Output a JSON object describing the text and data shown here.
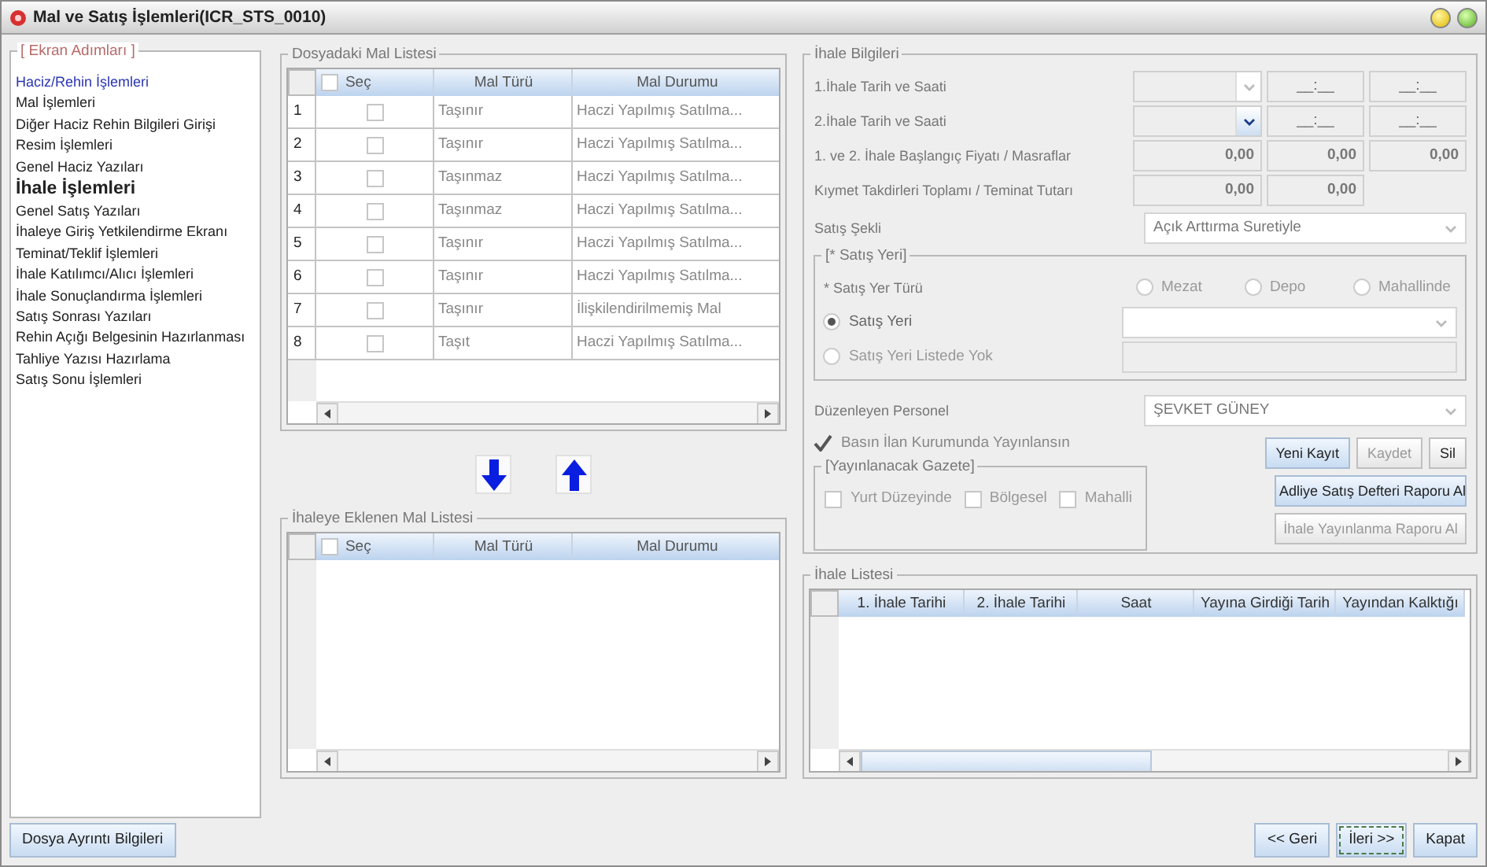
{
  "window": {
    "title": "Mal ve Satış İşlemleri(ICR_STS_0010)"
  },
  "sidebar": {
    "legend": "[ Ekran Adımları ]",
    "items": [
      {
        "label": "Haciz/Rehin İşlemleri",
        "kind": "link",
        "selected": false
      },
      {
        "label": "Mal İşlemleri",
        "kind": "step",
        "selected": false
      },
      {
        "label": "Diğer Haciz Rehin Bilgileri Girişi",
        "kind": "step",
        "selected": false
      },
      {
        "label": "Resim İşlemleri",
        "kind": "step",
        "selected": false
      },
      {
        "label": "Genel Haciz Yazıları",
        "kind": "step",
        "selected": false
      },
      {
        "label": "İhale İşlemleri",
        "kind": "step",
        "selected": true
      },
      {
        "label": "Genel Satış Yazıları",
        "kind": "step",
        "selected": false
      },
      {
        "label": "İhaleye Giriş Yetkilendirme Ekranı",
        "kind": "step",
        "selected": false
      },
      {
        "label": "Teminat/Teklif İşlemleri",
        "kind": "step",
        "selected": false
      },
      {
        "label": "İhale Katılımcı/Alıcı İşlemleri",
        "kind": "step",
        "selected": false
      },
      {
        "label": "İhale Sonuçlandırma İşlemleri",
        "kind": "step",
        "selected": false
      },
      {
        "label": "Satış Sonrası Yazıları",
        "kind": "step",
        "selected": false
      },
      {
        "label": "Rehin Açığı Belgesinin Hazırlanması",
        "kind": "step",
        "selected": false
      },
      {
        "label": "Tahliye Yazısı Hazırlama",
        "kind": "step",
        "selected": false
      },
      {
        "label": "Satış Sonu İşlemleri",
        "kind": "step",
        "selected": false
      }
    ]
  },
  "mal_listesi": {
    "legend": "Dosyadaki Mal Listesi",
    "columns": [
      "Seç",
      "Mal Türü",
      "Mal Durumu"
    ],
    "header_checked": false,
    "rows": [
      {
        "no": "1",
        "checked": false,
        "mal_turu": "Taşınır",
        "mal_durumu": "Haczi Yapılmış Satılma..."
      },
      {
        "no": "2",
        "checked": false,
        "mal_turu": "Taşınır",
        "mal_durumu": "Haczi Yapılmış Satılma..."
      },
      {
        "no": "3",
        "checked": false,
        "mal_turu": "Taşınmaz",
        "mal_durumu": "Haczi Yapılmış Satılma..."
      },
      {
        "no": "4",
        "checked": false,
        "mal_turu": "Taşınmaz",
        "mal_durumu": "Haczi Yapılmış Satılma..."
      },
      {
        "no": "5",
        "checked": false,
        "mal_turu": "Taşınır",
        "mal_durumu": "Haczi Yapılmış Satılma..."
      },
      {
        "no": "6",
        "checked": false,
        "mal_turu": "Taşınır",
        "mal_durumu": "Haczi Yapılmış Satılma..."
      },
      {
        "no": "7",
        "checked": false,
        "mal_turu": "Taşınır",
        "mal_durumu": "İlişkilendirilmemiş Mal"
      },
      {
        "no": "8",
        "checked": false,
        "mal_turu": "Taşıt",
        "mal_durumu": "Haczi Yapılmış Satılma..."
      }
    ]
  },
  "eklenen_listesi": {
    "legend": "İhaleye Eklenen Mal Listesi",
    "columns": [
      "Seç",
      "Mal Türü",
      "Mal Durumu"
    ],
    "header_checked": false
  },
  "ihale_bilgileri": {
    "legend": "İhale Bilgileri",
    "tarih_1": {
      "label": "1.İhale Tarih ve Saati",
      "disabled": true,
      "times": [
        "__:__",
        "__:__"
      ]
    },
    "tarih_2": {
      "label": "2.İhale Tarih ve Saati",
      "disabled": false,
      "times": [
        "__:__",
        "__:__"
      ]
    },
    "fiyat": {
      "label": "1. ve 2. İhale Başlangıç Fiyatı / Masraflar",
      "values": [
        "0,00",
        "0,00",
        "0,00"
      ]
    },
    "kiymet": {
      "label": "Kıymet Takdirleri Toplamı / Teminat Tutarı",
      "values": [
        "0,00",
        "0,00"
      ]
    },
    "satis_sekli": {
      "label": "Satış Şekli",
      "value": "Açık Arttırma Suretiyle"
    },
    "satis_yeri": {
      "legend": "[* Satış Yeri]",
      "type_label": "* Satış Yer Türü",
      "types": [
        {
          "label": "Mezat",
          "selected": false
        },
        {
          "label": "Depo",
          "selected": false
        },
        {
          "label": "Mahallinde",
          "selected": false
        }
      ],
      "options": [
        {
          "label": "Satış Yeri",
          "selected": true
        },
        {
          "label": "Satış Yeri Listede Yok",
          "selected": false
        }
      ]
    },
    "personel": {
      "label": "Düzenleyen Personel",
      "value": "ŞEVKET GÜNEY"
    },
    "basin": {
      "label": "Basın İlan Kurumunda Yayınlansın",
      "checked": true
    },
    "gazete": {
      "legend": "[Yayınlanacak Gazete]",
      "options": [
        {
          "label": "Yurt Düzeyinde",
          "checked": false
        },
        {
          "label": "Bölgesel",
          "checked": false
        },
        {
          "label": "Mahalli",
          "checked": false
        }
      ]
    },
    "buttons": [
      {
        "label": "Yeni Kayıt",
        "kind": "row",
        "highlighted": true,
        "disabled": false
      },
      {
        "label": "Kaydet",
        "kind": "row",
        "highlighted": false,
        "disabled": true
      },
      {
        "label": "Sil",
        "kind": "row",
        "highlighted": false,
        "disabled": false
      },
      {
        "label": "Adliye Satış Defteri Raporu Al",
        "kind": "wide",
        "highlighted": true,
        "disabled": false
      },
      {
        "label": "İhale Yayınlanma Raporu Al",
        "kind": "wide",
        "highlighted": false,
        "disabled": true
      }
    ]
  },
  "ihale_listesi": {
    "legend": "İhale Listesi",
    "columns": [
      "1. İhale Tarihi",
      "2. İhale Tarihi",
      "Saat",
      "Yayına Girdiği Tarih",
      "Yayından Kalktığı"
    ]
  },
  "footer": {
    "left": {
      "label": "Dosya Ayrıntı Bilgileri"
    },
    "nav": [
      {
        "label": "<< Geri",
        "focused": false
      },
      {
        "label": "İleri >>",
        "focused": true
      },
      {
        "label": "Kapat",
        "focused": false
      }
    ]
  }
}
